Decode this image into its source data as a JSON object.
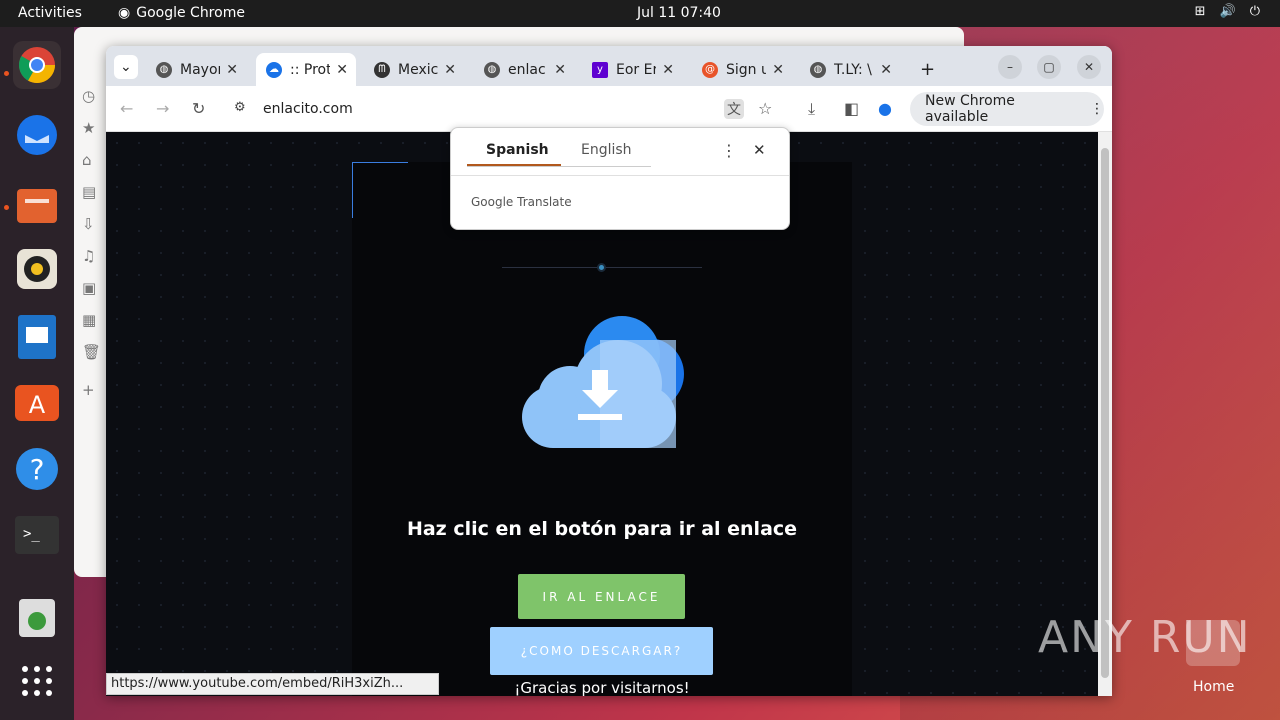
{
  "topbar": {
    "activities": "Activities",
    "app_name": "Google Chrome",
    "clock": "Jul 11  07:40",
    "sys_icons": [
      "network-icon",
      "volume-icon",
      "power-icon"
    ]
  },
  "dock": {
    "items": [
      "chrome",
      "thunderbird",
      "files",
      "rhythmbox",
      "writer",
      "app-center",
      "help",
      "terminal",
      "trash",
      "apps-grid"
    ]
  },
  "tabs": [
    {
      "label": "Mayor",
      "icon": "globe"
    },
    {
      "label": ":: Prot",
      "icon": "cloud"
    },
    {
      "label": "Mexic",
      "icon": "wave"
    },
    {
      "label": "enlac",
      "icon": "globe"
    },
    {
      "label": "Eor Er",
      "icon": "yahoo"
    },
    {
      "label": "Sign u",
      "icon": "spiral"
    },
    {
      "label": "T.LY: \\",
      "icon": "globe"
    }
  ],
  "toolbar": {
    "url": "enlacito.com",
    "new_chrome": "New Chrome available"
  },
  "translate_popup": {
    "lang_from": "Spanish",
    "lang_to": "English",
    "brand": "Google Translate"
  },
  "page": {
    "heading": "Haz clic en el botón para ir al enlace",
    "btn_go": "IR AL ENLACE",
    "btn_how": "¿COMO DESCARGAR?",
    "thanks": "¡Gracias por visitarnos!"
  },
  "status_url": "https://www.youtube.com/embed/RiH3xiZh...",
  "watermark": "ANY RUN",
  "desktop": {
    "home_label": "Home"
  },
  "colors": {
    "go": "#7fc46a",
    "how": "#9fd0ff",
    "accent_ubuntu": "#e95420"
  }
}
